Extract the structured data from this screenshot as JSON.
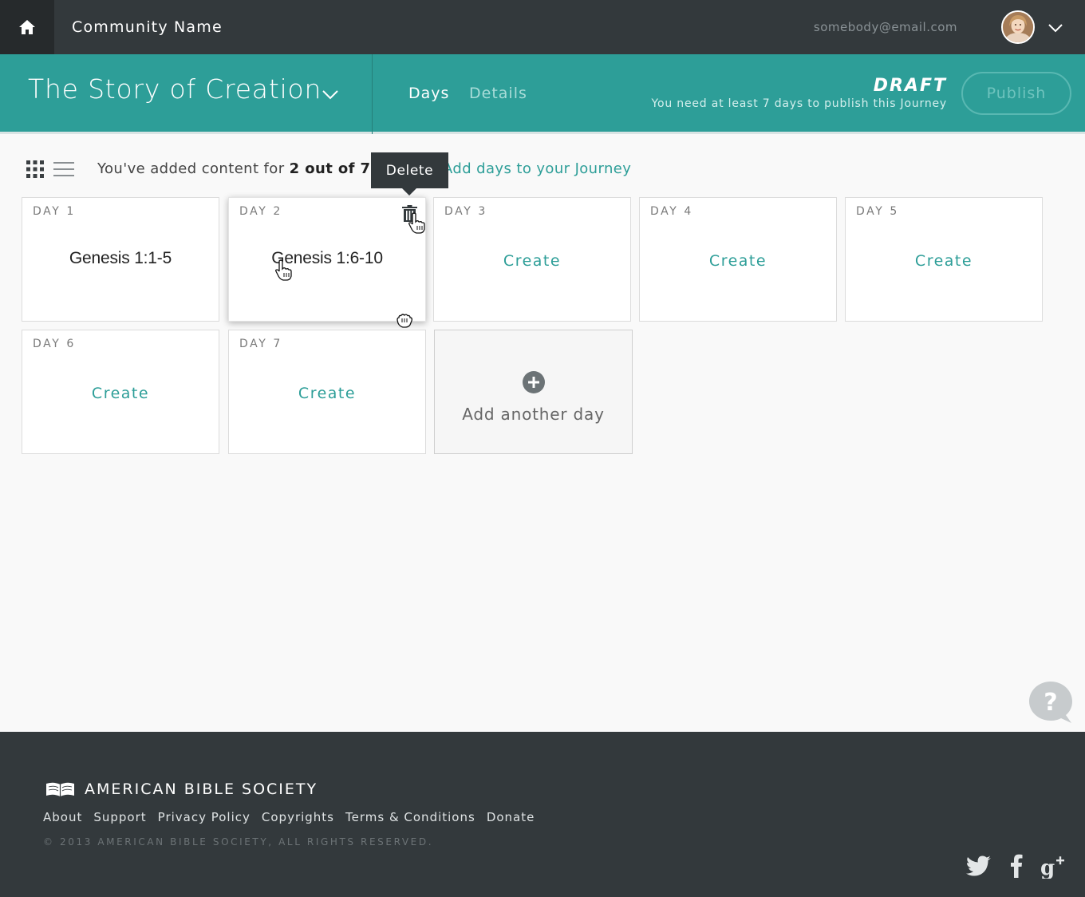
{
  "topbar": {
    "community_name": "Community Name",
    "email": "somebody@email.com"
  },
  "journey": {
    "title": "The Story of Creation",
    "tabs": [
      {
        "label": "Days"
      },
      {
        "label": "Details"
      }
    ],
    "status": "DRAFT",
    "status_note": "You need at least 7 days to publish this Journey",
    "publish_label": "Publish"
  },
  "toolbar": {
    "progress_prefix": "You've added content for ",
    "progress_count": "2 out of 7",
    "link_label": "Add days to your Journey"
  },
  "tooltip": {
    "label": "Delete"
  },
  "days": [
    {
      "day": "DAY 1",
      "content": "Genesis 1:1-5"
    },
    {
      "day": "DAY 2",
      "content": "Genesis 1:6-10"
    },
    {
      "day": "DAY 3",
      "action": "Create"
    },
    {
      "day": "DAY 4",
      "action": "Create"
    },
    {
      "day": "DAY 5",
      "action": "Create"
    },
    {
      "day": "DAY 6",
      "action": "Create"
    },
    {
      "day": "DAY 7",
      "action": "Create"
    }
  ],
  "add_day": {
    "label": "Add another day"
  },
  "footer": {
    "org_name": "AMERICAN BIBLE SOCIETY",
    "links": [
      "About",
      "Support",
      "Privacy Policy",
      "Copyrights",
      "Terms & Conditions",
      "Donate"
    ],
    "copyright": "© 2013 AMERICAN BIBLE SOCIETY, ALL RIGHTS RESERVED."
  },
  "colors": {
    "accent": "#2d9e98",
    "topbar": "#33393c",
    "footer": "#33393c"
  },
  "icons": [
    "home-icon",
    "chevron-down-icon",
    "grid-view-icon",
    "list-view-icon",
    "trash-icon",
    "hand-cursor-icon",
    "grab-cursor-icon",
    "plus-icon",
    "help-icon",
    "bible-logo-icon",
    "twitter-icon",
    "facebook-icon",
    "google-plus-icon"
  ]
}
